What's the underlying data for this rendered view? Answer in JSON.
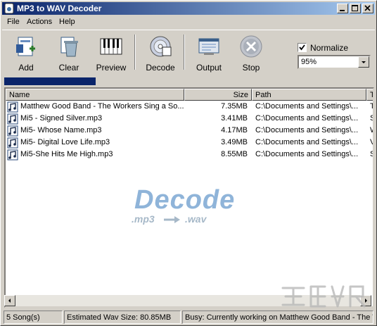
{
  "window": {
    "title": "MP3 to WAV Decoder"
  },
  "menu": [
    "File",
    "Actions",
    "Help"
  ],
  "toolbar": {
    "add": "Add",
    "clear": "Clear",
    "preview": "Preview",
    "decode": "Decode",
    "output": "Output",
    "stop": "Stop"
  },
  "options": {
    "normalize_label": "Normalize",
    "normalize_checked": true,
    "level": "95%"
  },
  "progress": {
    "fraction": 0.25
  },
  "list": {
    "columns": [
      "Name",
      "Size",
      "Path",
      "T"
    ],
    "rows": [
      {
        "name": "Matthew Good Band - The Workers Sing a So...",
        "size": "7.35MB",
        "path": "C:\\Documents and Settings\\...",
        "t": "T"
      },
      {
        "name": "Mi5 - Signed Silver.mp3",
        "size": "3.41MB",
        "path": "C:\\Documents and Settings\\...",
        "t": "S"
      },
      {
        "name": "Mi5- Whose Name.mp3",
        "size": "4.17MB",
        "path": "C:\\Documents and Settings\\...",
        "t": "W"
      },
      {
        "name": "Mi5- Digital Love Life.mp3",
        "size": "3.49MB",
        "path": "C:\\Documents and Settings\\...",
        "t": "V"
      },
      {
        "name": "Mi5-She Hits Me High.mp3",
        "size": "8.55MB",
        "path": "C:\\Documents and Settings\\...",
        "t": "S"
      }
    ]
  },
  "watermark": {
    "main": "Decode",
    "from": ".mp3",
    "to": ".wav"
  },
  "status": {
    "songs": "5 Song(s)",
    "estimated": "Estimated Wav Size: 80.85MB",
    "busy": "Busy: Currently working on Matthew Good Band - The W"
  },
  "colors": {
    "title_start": "#0a246a",
    "title_end": "#a6caf0",
    "progress": "#0a246a",
    "watermark": "#8fb4d9"
  }
}
